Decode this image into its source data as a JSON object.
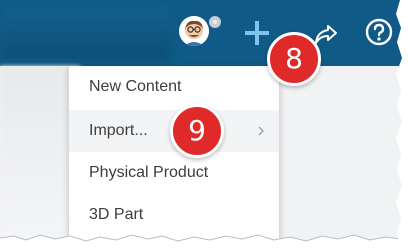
{
  "header": {
    "avatar_icon": "user-avatar-icon",
    "add_icon": "plus-icon",
    "share_icon": "share-icon",
    "help_icon": "help-icon",
    "brand_color": "#0f5a86"
  },
  "callouts": [
    {
      "number": "8",
      "color": "#e02a2a"
    },
    {
      "number": "9",
      "color": "#e02a2a"
    }
  ],
  "menu": {
    "items": [
      {
        "label": "New Content"
      },
      {
        "label": "Import...",
        "submenu_icon": "chevron-right-icon"
      },
      {
        "label": "Physical Product"
      },
      {
        "label": "3D Part"
      }
    ]
  }
}
